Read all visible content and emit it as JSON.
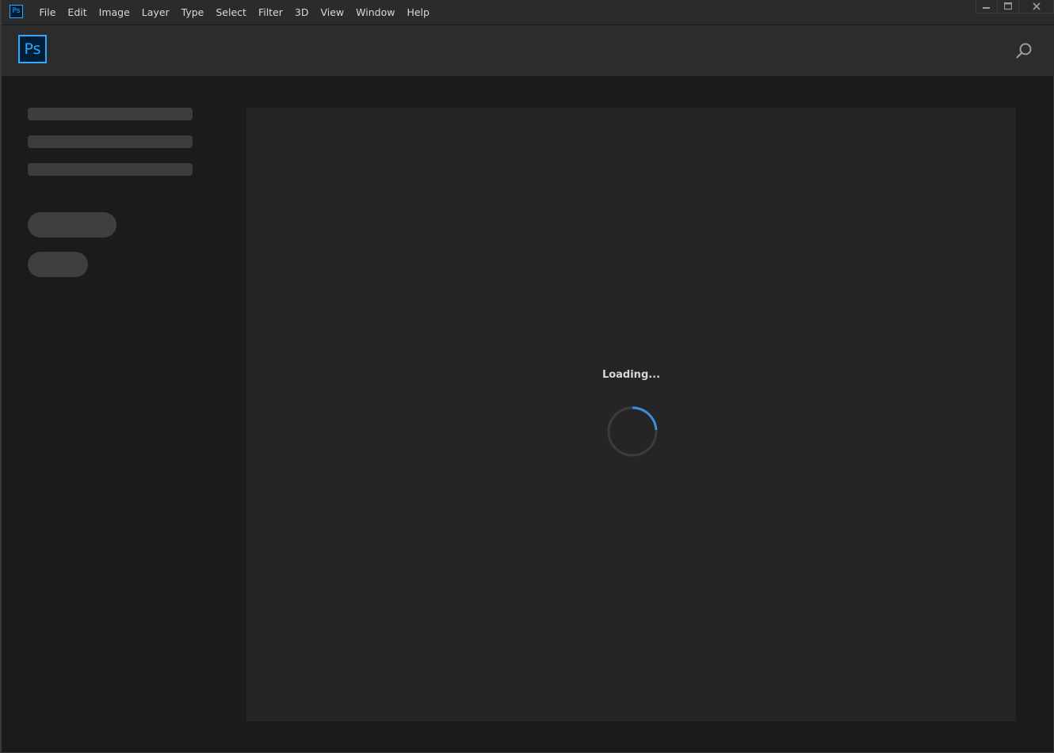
{
  "app": {
    "icon_label": "Ps",
    "logo_label": "Ps",
    "accent_color": "#31a8ff"
  },
  "menubar": {
    "items": [
      "File",
      "Edit",
      "Image",
      "Layer",
      "Type",
      "Select",
      "Filter",
      "3D",
      "View",
      "Window",
      "Help"
    ]
  },
  "window_controls": {
    "icons": [
      "minimize-icon",
      "maximize-icon",
      "close-icon"
    ]
  },
  "header": {
    "search_icon": "search-icon"
  },
  "main": {
    "loading_text": "Loading...",
    "spinner_color": "#3b8fe0"
  }
}
